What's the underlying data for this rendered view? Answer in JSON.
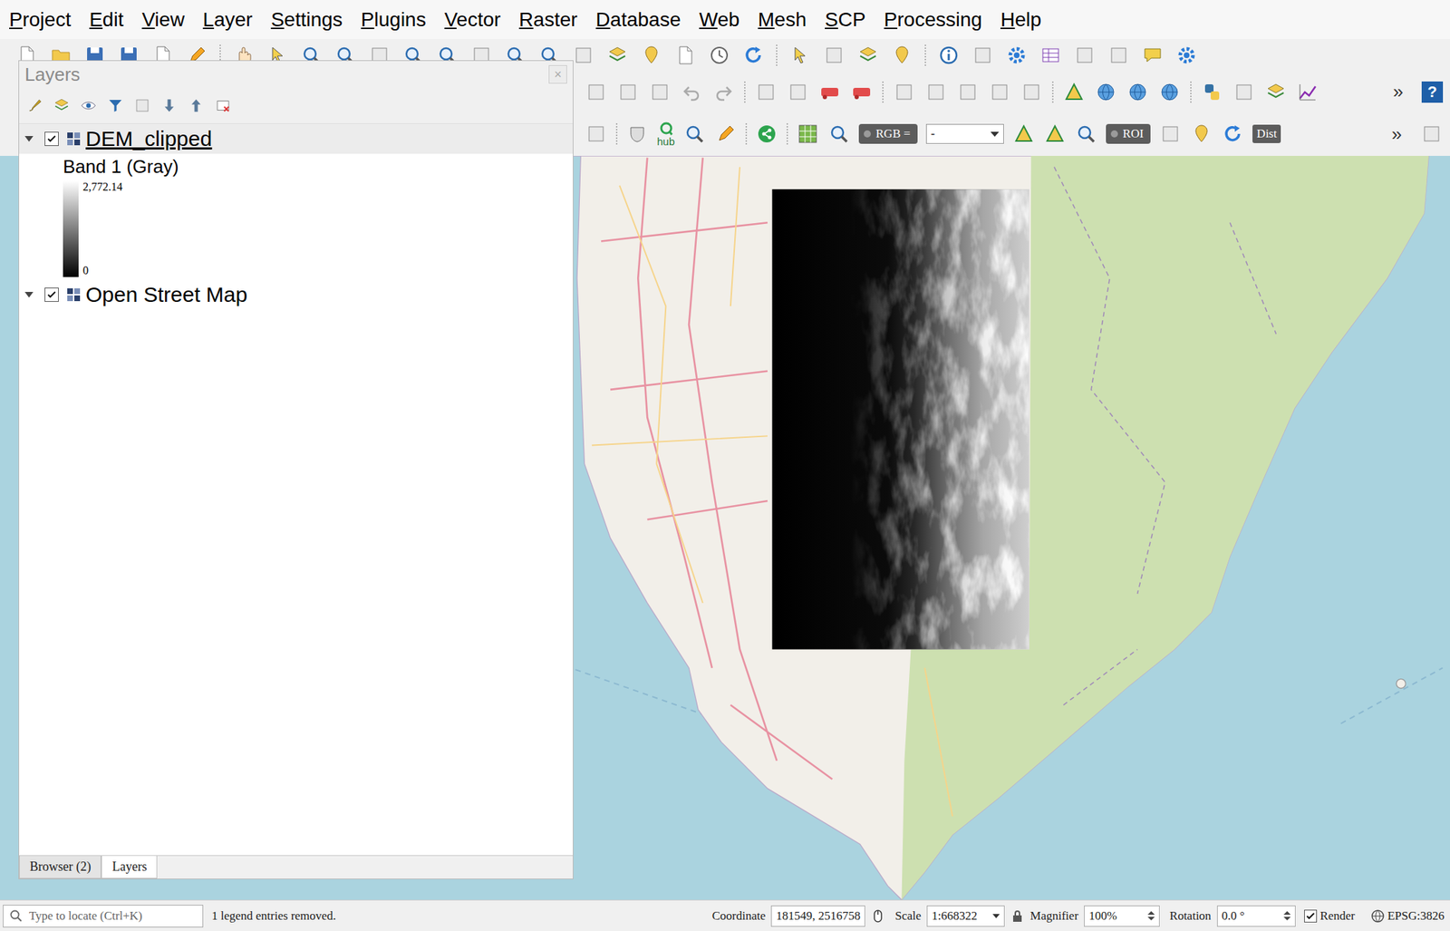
{
  "menu": [
    "Project",
    "Edit",
    "View",
    "Layer",
    "Settings",
    "Plugins",
    "Vector",
    "Raster",
    "Database",
    "Web",
    "Mesh",
    "SCP",
    "Processing",
    "Help"
  ],
  "toolbars": {
    "row2": {
      "overflow": "»",
      "help": "?"
    },
    "row3": {
      "hub": "hub",
      "rgb": {
        "label": "RGB =",
        "on": false
      },
      "rgb_value": "-",
      "roi": {
        "label": "ROI",
        "on": false
      },
      "dist": "Dist",
      "overflow": "»"
    }
  },
  "layers_panel": {
    "title": "Layers",
    "close": "×",
    "layers": [
      {
        "name": "DEM_clipped",
        "visible": true,
        "expanded": true,
        "current": true,
        "legend": {
          "band": "Band 1 (Gray)",
          "max": "2,772.14",
          "min": "0"
        }
      },
      {
        "name": "Open Street Map",
        "visible": true,
        "expanded": true,
        "current": false
      }
    ],
    "tabs": [
      {
        "label": "Browser (2)",
        "selected": false
      },
      {
        "label": "Layers",
        "selected": true
      }
    ]
  },
  "status_bar": {
    "search_placeholder": "Type to locate (Ctrl+K)",
    "message": "1 legend entries removed.",
    "coordinate_label": "Coordinate",
    "coordinate": "181549, 2516758",
    "scale_label": "Scale",
    "scale": "1:668322",
    "magnifier_label": "Magnifier",
    "magnifier": "100%",
    "rotation_label": "Rotation",
    "rotation": "0.0 °",
    "render_label": "Render",
    "render": true,
    "crs": "EPSG:3826"
  }
}
